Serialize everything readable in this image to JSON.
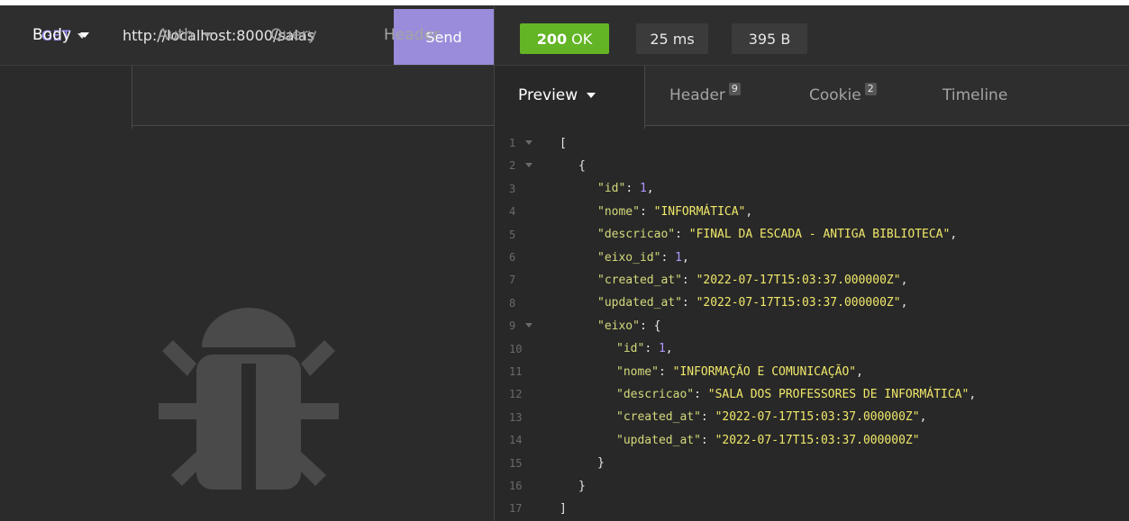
{
  "request": {
    "method": "GET",
    "url": "http://localhost:8000/salas",
    "send_label": "Send",
    "tabs": [
      {
        "label": "Body",
        "has_caret": true,
        "active": true
      },
      {
        "label": "Auth",
        "has_caret": true,
        "active": false
      },
      {
        "label": "Query",
        "has_caret": false,
        "active": false
      },
      {
        "label": "Header",
        "has_caret": false,
        "active": false
      }
    ],
    "empty_state_icon": "bug-icon"
  },
  "response": {
    "status_code": "200",
    "status_text": "OK",
    "time": "25 ms",
    "size": "395 B",
    "tabs": [
      {
        "label": "Preview",
        "badge": "",
        "active": true
      },
      {
        "label": "Header",
        "badge": "9",
        "active": false
      },
      {
        "label": "Cookie",
        "badge": "2",
        "active": false
      },
      {
        "label": "Timeline",
        "badge": "",
        "active": false
      }
    ],
    "json_lines": [
      {
        "n": "1",
        "fold": true,
        "indent": 0,
        "text": "["
      },
      {
        "n": "2",
        "fold": true,
        "indent": 1,
        "text": "{"
      },
      {
        "n": "3",
        "fold": false,
        "indent": 2,
        "key": "\"id\"",
        "num": "1",
        "tail": ","
      },
      {
        "n": "4",
        "fold": false,
        "indent": 2,
        "key": "\"nome\"",
        "str": "\"INFORMÁTICA\"",
        "tail": ","
      },
      {
        "n": "5",
        "fold": false,
        "indent": 2,
        "key": "\"descricao\"",
        "str": "\"FINAL DA ESCADA - ANTIGA BIBLIOTECA\"",
        "tail": ","
      },
      {
        "n": "6",
        "fold": false,
        "indent": 2,
        "key": "\"eixo_id\"",
        "num": "1",
        "tail": ","
      },
      {
        "n": "7",
        "fold": false,
        "indent": 2,
        "key": "\"created_at\"",
        "str": "\"2022-07-17T15:03:37.000000Z\"",
        "tail": ","
      },
      {
        "n": "8",
        "fold": false,
        "indent": 2,
        "key": "\"updated_at\"",
        "str": "\"2022-07-17T15:03:37.000000Z\"",
        "tail": ","
      },
      {
        "n": "9",
        "fold": true,
        "indent": 2,
        "key": "\"eixo\"",
        "open": "{"
      },
      {
        "n": "10",
        "fold": false,
        "indent": 3,
        "key": "\"id\"",
        "num": "1",
        "tail": ","
      },
      {
        "n": "11",
        "fold": false,
        "indent": 3,
        "key": "\"nome\"",
        "str": "\"INFORMAÇÃO E COMUNICAÇÃO\"",
        "tail": ","
      },
      {
        "n": "12",
        "fold": false,
        "indent": 3,
        "key": "\"descricao\"",
        "str": "\"SALA DOS PROFESSORES DE INFORMÁTICA\"",
        "tail": ","
      },
      {
        "n": "13",
        "fold": false,
        "indent": 3,
        "key": "\"created_at\"",
        "str": "\"2022-07-17T15:03:37.000000Z\"",
        "tail": ","
      },
      {
        "n": "14",
        "fold": false,
        "indent": 3,
        "key": "\"updated_at\"",
        "str": "\"2022-07-17T15:03:37.000000Z\"",
        "tail": ""
      },
      {
        "n": "15",
        "fold": false,
        "indent": 2,
        "text": "}"
      },
      {
        "n": "16",
        "fold": false,
        "indent": 1,
        "text": "}"
      },
      {
        "n": "17",
        "fold": false,
        "indent": 0,
        "text": "]"
      }
    ]
  },
  "colors": {
    "method": "#9f95ff",
    "send": "#9a8cdb",
    "status_ok": "#63b526",
    "json_key": "#d4d97c",
    "json_string": "#f0e86a",
    "json_number": "#b098ff"
  }
}
